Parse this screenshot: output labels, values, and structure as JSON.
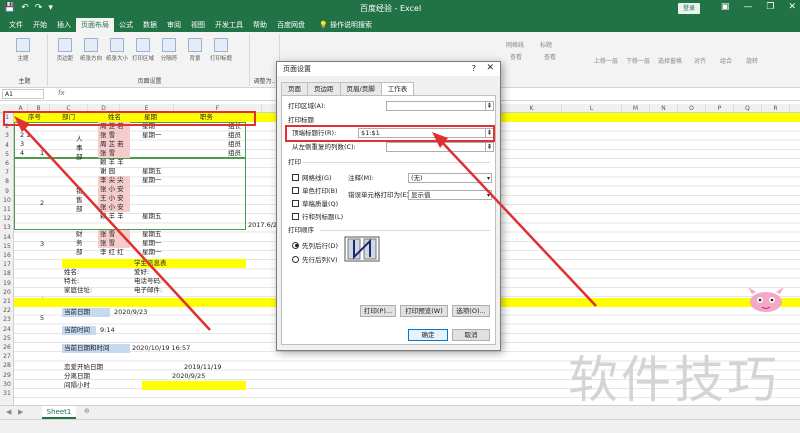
{
  "titlebar": {
    "window_title": "百度经验  -  Excel",
    "login_label": "登录",
    "qat": [
      "💾",
      "↶",
      "↷",
      "▾"
    ],
    "controls": [
      "—",
      "❐",
      "✕"
    ],
    "ribbon_toggle": "▣"
  },
  "tabs": [
    {
      "label": "文件"
    },
    {
      "label": "开始"
    },
    {
      "label": "插入"
    },
    {
      "label": "页面布局",
      "active": true
    },
    {
      "label": "公式"
    },
    {
      "label": "数据"
    },
    {
      "label": "审阅"
    },
    {
      "label": "视图"
    },
    {
      "label": "开发工具"
    },
    {
      "label": "帮助"
    },
    {
      "label": "百度网盘"
    },
    {
      "label": "操作说明搜索",
      "search": true
    }
  ],
  "ribbon": {
    "groups": [
      "主题",
      "页面设置",
      "调整为..."
    ],
    "theme_btn": "主题",
    "page_btns": [
      "页边距",
      "纸张方向",
      "纸张大小",
      "打印区域",
      "分隔符",
      "背景",
      "打印标题"
    ],
    "right_labels": [
      "网格线",
      "标题",
      "查看",
      "查看",
      "上移一层",
      "下移一层",
      "选择窗格",
      "对齐",
      "组合",
      "旋转"
    ]
  },
  "formula_bar": {
    "name_box": "A1",
    "fx": "fx"
  },
  "columns": [
    "A",
    "B",
    "C",
    "D",
    "E",
    "F",
    "G",
    "H",
    "I",
    "J",
    "K",
    "L",
    "M",
    "N",
    "O",
    "P",
    "Q",
    "R",
    "S",
    "T",
    "U",
    "V",
    "W"
  ],
  "rows": [
    "1",
    "2",
    "3",
    "4",
    "5",
    "6",
    "7",
    "8",
    "9",
    "10",
    "11",
    "12",
    "13",
    "14",
    "15",
    "16",
    "17",
    "18",
    "19",
    "20",
    "21",
    "22",
    "23",
    "24",
    "25",
    "26",
    "27",
    "28",
    "29",
    "30",
    "31"
  ],
  "sheet": {
    "header_row": [
      "序号",
      "部门",
      "姓名",
      "星期",
      "职务"
    ],
    "seq": [
      "1",
      "2",
      "3",
      "4",
      "5"
    ],
    "dept1": [
      "人",
      "事",
      "部"
    ],
    "dept2": [
      "销",
      "售",
      "部"
    ],
    "dept3": [
      "财",
      "务",
      "部"
    ],
    "names": [
      "周 芷 若",
      "张    雪",
      "周 芷 若",
      "张    雪",
      "赖 羊 羊",
      "谢    园",
      "李 尖 尖",
      "张 小 安",
      "王 小 安",
      "张 小 安",
      "赖 羊 羊",
      "张    雪",
      "张    雪",
      "李 红 红"
    ],
    "weekdays": [
      "星期一",
      "星期一",
      "星期五",
      "星期一",
      "星期五",
      "星期一",
      "星期一",
      "星期五"
    ],
    "jobs": [
      "组长",
      "组员",
      "组员",
      "组员"
    ],
    "date_partial": "2017.6/23",
    "info_title": "学生信息表",
    "form_labels": [
      "姓名:",
      "特长:",
      "家庭住址:",
      "爱好:",
      "电话号码:",
      "电子邮件:"
    ],
    "labels": [
      "当前日期",
      "当前时间",
      "当前日期和时间",
      "恋爱开始日期",
      "分离日期",
      "间隔小时"
    ],
    "values": [
      "2020/9/23",
      "9:14",
      "2020/10/19 16:57",
      "2019/11/19",
      "2020/9/25"
    ]
  },
  "sheet_tabs": {
    "active": "Sheet1",
    "add": "⊕",
    "nav": [
      "◀",
      "▶"
    ]
  },
  "watermark": "软件技巧",
  "dialog": {
    "title": "页面设置",
    "help": "?",
    "close": "✕",
    "tabs": [
      "页面",
      "页边距",
      "页眉/页脚",
      "工作表"
    ],
    "active_tab": "工作表",
    "print_area_label": "打印区域(A):",
    "print_area_value": "",
    "print_titles_label": "打印标题",
    "top_rows_label": "顶端标题行(R):",
    "top_rows_value": "$1:$1",
    "left_cols_label": "从左侧重复的列数(C):",
    "left_cols_value": "",
    "print_section": "打印",
    "checkboxes": [
      "网格线(G)",
      "单色打印(B)",
      "草稿质量(Q)",
      "行和列标题(L)"
    ],
    "comments_label": "注释(M):",
    "comments_value": "(无)",
    "errors_label": "错误单元格打印为(E):",
    "errors_value": "显示值",
    "order_section": "打印顺序",
    "radios": [
      "先列后行(D)",
      "先行后列(V)"
    ],
    "buttons": [
      "打印(P)...",
      "打印预览(W)",
      "选项(O)..."
    ],
    "ok": "确定",
    "cancel": "取消",
    "collapse_icon": "⇞",
    "dropdown_icon": "▾"
  },
  "colors": {
    "excel_green": "#217346",
    "highlight_yellow": "#ffff00",
    "annotation_red": "#e03030",
    "row_blue": "#c5d9f1",
    "name_pink": "#f4cccc"
  }
}
